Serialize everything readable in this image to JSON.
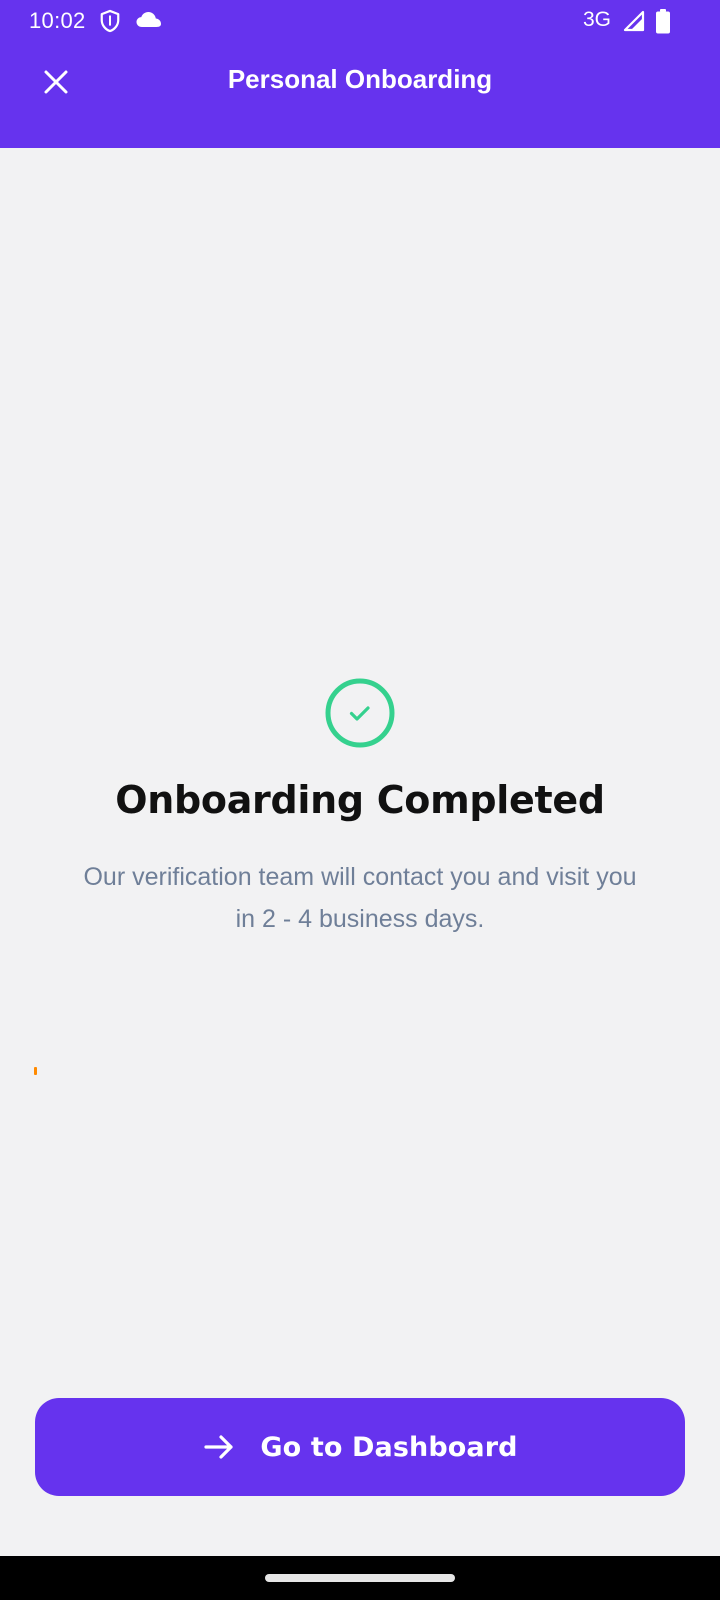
{
  "status_bar": {
    "time": "10:02",
    "network": "3G",
    "icons": [
      "shield-icon",
      "cloud-icon",
      "signal-icon",
      "battery-icon"
    ]
  },
  "app_bar": {
    "title": "Personal Onboarding",
    "close_icon": "close-icon"
  },
  "content": {
    "status_icon": "check-circle-icon",
    "headline": "Onboarding Completed",
    "message": "Our verification team will contact you and visit you in 2 - 4 business days."
  },
  "cta": {
    "label": "Go to Dashboard",
    "icon": "arrow-right-icon"
  },
  "colors": {
    "primary": "#6633EE",
    "success": "#35D18E",
    "text_secondary": "#6F7F98",
    "background": "#F2F2F3"
  }
}
